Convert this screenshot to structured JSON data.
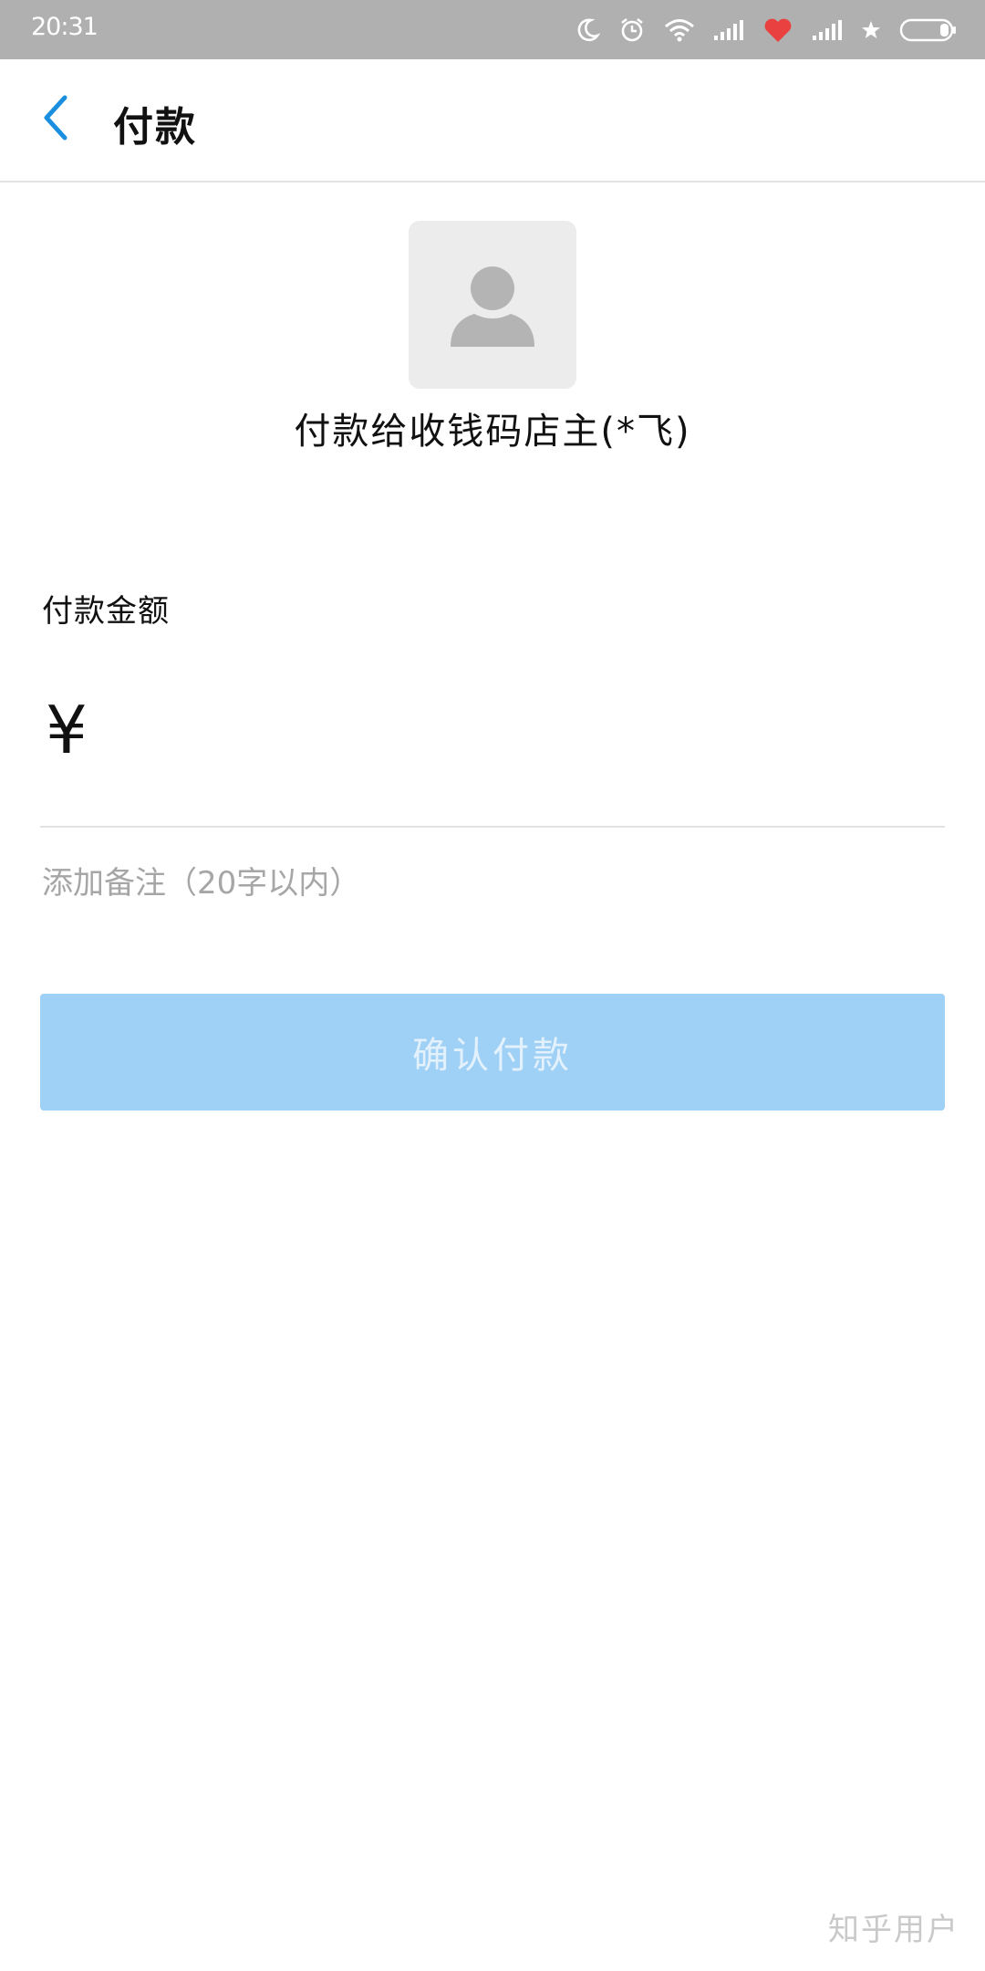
{
  "status_bar": {
    "time": "20:31",
    "icons": [
      "moon-icon",
      "alarm-icon",
      "wifi-icon",
      "signal-icon",
      "heart-icon",
      "signal-icon",
      "star-icon",
      "battery-icon"
    ],
    "colors": {
      "background": "#b0b0b0",
      "heart": "#e8413f"
    }
  },
  "nav": {
    "back_icon": "chevron-left-icon",
    "title": "付款"
  },
  "payee": {
    "avatar_icon": "person-icon",
    "label": "付款给收钱码店主(*飞)"
  },
  "amount": {
    "label": "付款金额",
    "currency": "¥",
    "value": ""
  },
  "note": {
    "placeholder": "添加备注（20字以内）",
    "value": ""
  },
  "confirm_button": {
    "label": "确认付款",
    "colors": {
      "background": "#9fd0f5",
      "text": "#e3f1fc"
    }
  },
  "watermark": "知乎用户",
  "accent_color": "#1a8fe0"
}
